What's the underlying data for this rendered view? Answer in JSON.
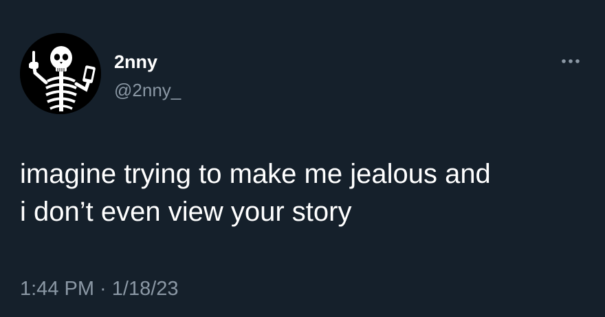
{
  "author": {
    "display_name": "2nny",
    "handle": "@2nny_",
    "avatar_icon": "skeleton-middle-finger-icon"
  },
  "tweet": {
    "text_line_1": "imagine trying to make me jealous and",
    "text_line_2": "i don’t even view your story",
    "timestamp": "1:44 PM · 1/18/23"
  },
  "icons": {
    "more": "more-options-icon"
  },
  "colors": {
    "background": "#15202b",
    "primary_text": "#ffffff",
    "secondary_text": "#8b98a5"
  }
}
